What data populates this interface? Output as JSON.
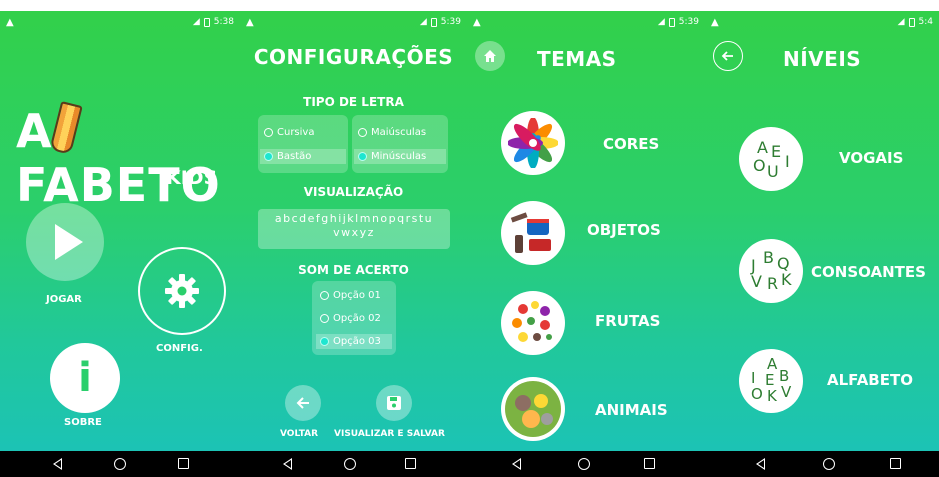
{
  "colors": {
    "accent_green": "#2bcf6c",
    "accent_teal": "#1cc3b5"
  },
  "statusbars": [
    {
      "time": "5:38"
    },
    {
      "time": "5:39"
    },
    {
      "time": "5:39"
    },
    {
      "time": "5:4"
    }
  ],
  "home": {
    "logo_start": "A",
    "logo_end": "FABETO",
    "subtitle": "KIDS",
    "play_label": "JOGAR",
    "config_label": "CONFIG.",
    "about_label": "SOBRE",
    "info_glyph": "i"
  },
  "config": {
    "title": "CONFIGURAÇÕES",
    "font_type_label": "TIPO DE LETRA",
    "opt_cursiva": "Cursiva",
    "opt_bastao": "Bastão",
    "opt_maiusculas": "Maiúsculas",
    "opt_minusculas": "Minúsculas",
    "preview_label": "VISUALIZAÇÃO",
    "preview_text": "abcdefghijklmnopqrstu vwxyz",
    "sound_label": "SOM DE ACERTO",
    "sound_options": [
      "Opção 01",
      "Opção 02",
      "Opção 03"
    ],
    "back_label": "VOLTAR",
    "save_label": "VISUALIZAR E SALVAR"
  },
  "themes": {
    "title": "TEMAS",
    "items": [
      "CORES",
      "OBJETOS",
      "FRUTAS",
      "ANIMAIS"
    ]
  },
  "levels": {
    "title": "NÍVEIS",
    "items": [
      {
        "label": "VOGAIS",
        "letters": [
          "A",
          "E",
          "O",
          "U",
          "I"
        ]
      },
      {
        "label": "CONSOANTES",
        "letters": [
          "J",
          "B",
          "Q",
          "V",
          "R",
          "K"
        ]
      },
      {
        "label": "ALFABETO",
        "letters": [
          "A",
          "I",
          "E",
          "B",
          "O",
          "K",
          "V"
        ]
      }
    ]
  }
}
